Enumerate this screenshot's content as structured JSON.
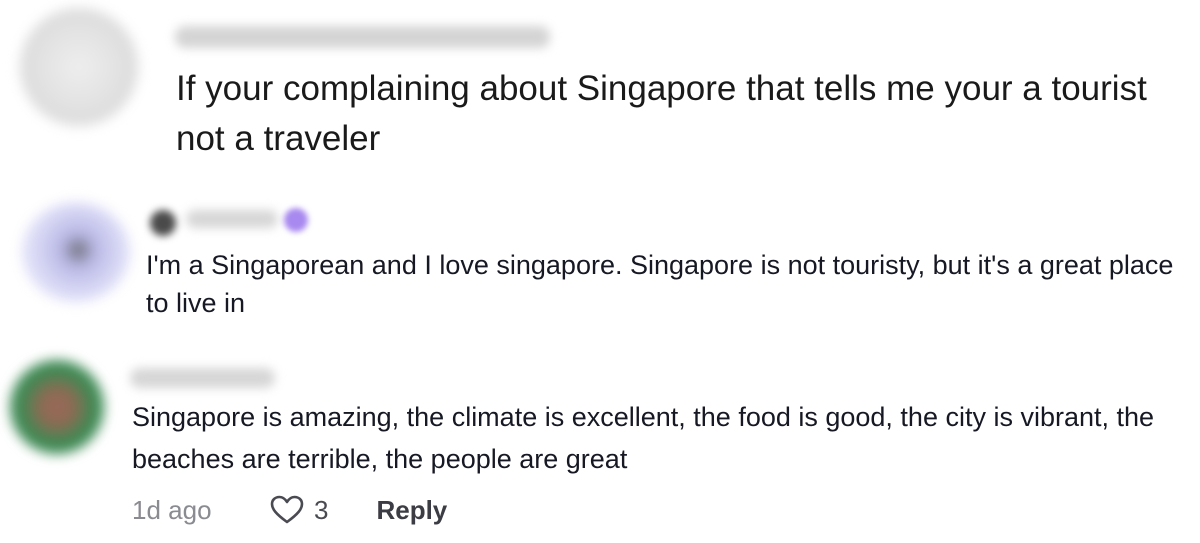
{
  "comments": [
    {
      "text": "If your complaining about Singapore that tells me your a tourist not a traveler"
    },
    {
      "text": "I'm a Singaporean and I love singapore. Singapore is not touristy, but it's a great place to live in"
    },
    {
      "text": "Singapore is amazing, the climate is excellent, the food is good, the city is vibrant, the beaches are terrible, the people are great",
      "time": "1d ago",
      "like_count": "3",
      "reply_label": "Reply"
    }
  ],
  "icons": {
    "like": "heart-outline-icon"
  },
  "colors": {
    "text": "#161823",
    "muted": "#8a8b91",
    "badge": "#a889ef"
  }
}
